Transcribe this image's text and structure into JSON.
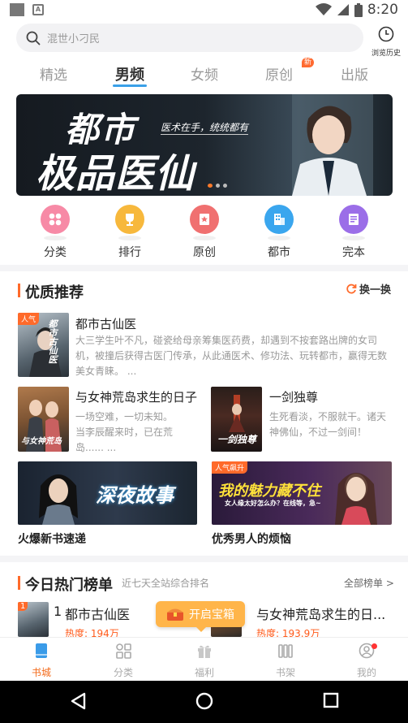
{
  "status_bar": {
    "time": "8:20",
    "notif_icon_letter": "A"
  },
  "search": {
    "placeholder": "混世小刁民"
  },
  "history": {
    "label": "浏览历史"
  },
  "tabs": [
    {
      "label": "精选"
    },
    {
      "label": "男频"
    },
    {
      "label": "女频"
    },
    {
      "label": "原创",
      "badge": "新"
    },
    {
      "label": "出版"
    }
  ],
  "active_tab": "男频",
  "banner": {
    "title_line1": "都市",
    "title_line2": "极品医仙",
    "subtitle": "医术在手，统统都有"
  },
  "categories": [
    {
      "label": "分类",
      "icon": "grid-icon",
      "color": "#f78aa6"
    },
    {
      "label": "排行",
      "icon": "trophy-icon",
      "color": "#f7b83c"
    },
    {
      "label": "原创",
      "icon": "bookmark-icon",
      "color": "#f07070"
    },
    {
      "label": "都市",
      "icon": "building-icon",
      "color": "#3aa6ee"
    },
    {
      "label": "完本",
      "icon": "list-icon",
      "color": "#9b6ee8"
    }
  ],
  "quality": {
    "title": "优质推荐",
    "refresh_label": "换一换",
    "featured": {
      "tag": "人气",
      "title": "都市古仙医",
      "desc": "大三学生叶不凡，碰瓷给母亲筹集医药费，却遇到不按套路出牌的女司机，被撞后获得古医门传承，从此通医术、修功法、玩转都市，赢得无数美女青睐。 ...",
      "cover_text": "都市古仙医"
    },
    "pair": [
      {
        "title": "与女神荒岛求生的日子",
        "desc": "一场空难，一切未知。当李辰醒来时，已在荒岛...... ...",
        "cover_text": "与女神荒岛"
      },
      {
        "title": "一剑独尊",
        "desc": "生死看淡，不服就干。诸天神佛仙，不过一剑间！",
        "cover_text": "一剑独尊"
      }
    ],
    "banners": [
      {
        "text": "深夜故事",
        "caption": "火爆新书速递",
        "tag": ""
      },
      {
        "text": "我的魅力藏不住",
        "subtext": "女人缘太好怎么办？在线等，急~",
        "caption": "优秀男人的烦恼",
        "tag": "人气飙升"
      }
    ]
  },
  "hot": {
    "title": "今日热门榜单",
    "subtitle": "近七天全站综合排名",
    "all_link": "全部榜单 >",
    "items": [
      {
        "rank": "1",
        "title": "都市古仙医",
        "heat": "热度: 194万"
      },
      {
        "rank": "",
        "title": "与女神荒岛求生的日...",
        "heat": "热度: 193.9万"
      }
    ]
  },
  "treasure": {
    "label": "开启宝箱"
  },
  "bottom_nav": [
    {
      "label": "书城",
      "icon": "book-icon",
      "active": true
    },
    {
      "label": "分类",
      "icon": "category-icon",
      "active": false
    },
    {
      "label": "福利",
      "icon": "gift-icon",
      "active": false
    },
    {
      "label": "书架",
      "icon": "bookshelf-icon",
      "active": false
    },
    {
      "label": "我的",
      "icon": "profile-icon",
      "active": false
    }
  ],
  "colors": {
    "accent": "#f36a1a",
    "tab_underline": "#3aa0e8"
  }
}
